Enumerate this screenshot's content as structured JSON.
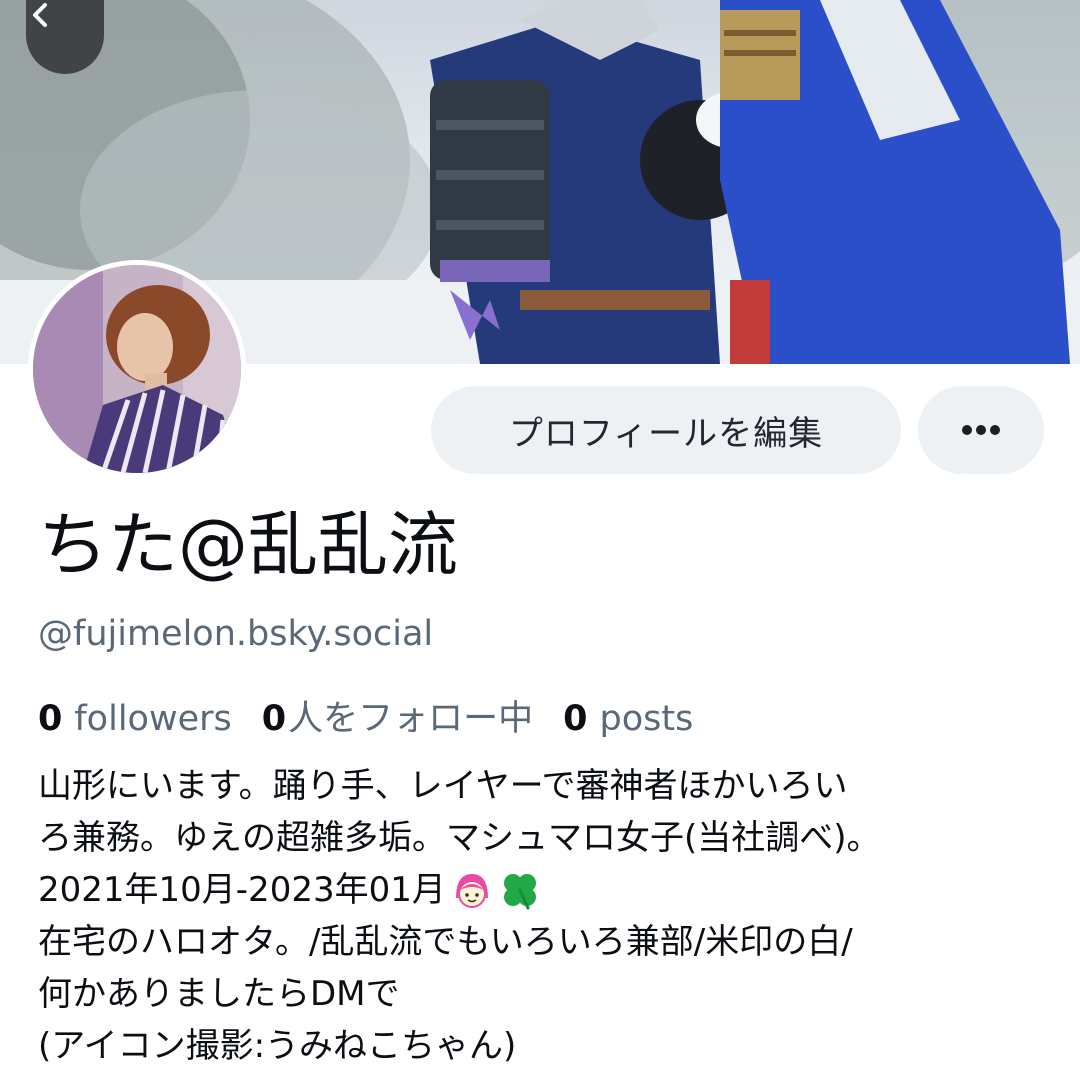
{
  "profile": {
    "display_name": "ちた@乱乱流",
    "handle": "@fujimelon.bsky.social",
    "edit_profile_label": "プロフィールを編集",
    "stats": {
      "followers_count": "0",
      "followers_label": "followers",
      "following_count": "0",
      "following_label": "人をフォロー中",
      "posts_count": "0",
      "posts_label": "posts"
    },
    "bio": {
      "line1": "山形にいます。踊り手、レイヤーで審神者ほかいろい",
      "line2": "ろ兼務。ゆえの超雑多垢。マシュマロ女子(当社調べ)。",
      "line3": "2021年10月-2023年01月",
      "line4": "在宅のハロオタ。/乱乱流でもいろいろ兼部/米印の白/",
      "line5": "何かありましたらDMで",
      "line6": "(アイコン撮影:うみねこちゃん)"
    }
  },
  "icons": {
    "back": "chevron-left-icon",
    "more": "ellipsis-icon",
    "emoji_1": "girl-emoji",
    "emoji_2": "four-leaf-clover-emoji"
  },
  "colors": {
    "button_bg": "#eef1f4",
    "secondary_text": "#5a6878",
    "primary_text": "#0b0f14"
  }
}
